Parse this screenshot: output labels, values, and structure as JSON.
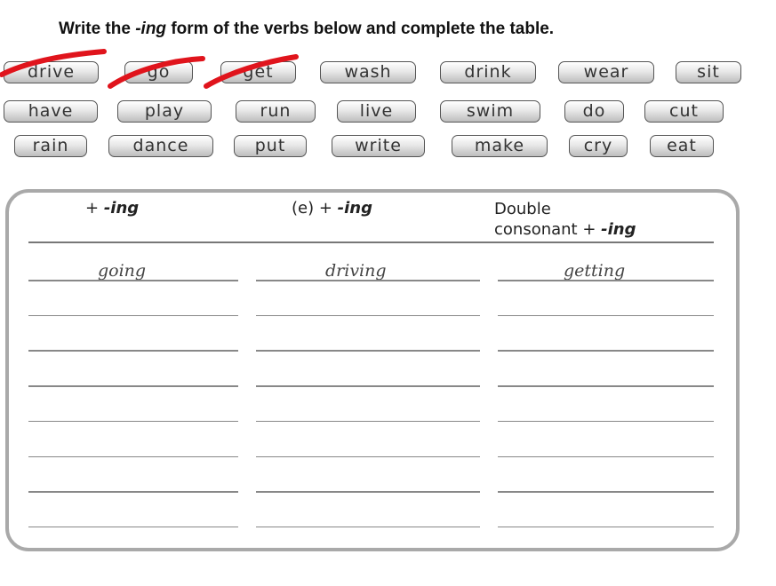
{
  "instruction": {
    "prefix": "Write  the ",
    "emphasis": "-ing",
    "suffix": " form of the verbs below and complete the table."
  },
  "word_bank": [
    {
      "word": "drive",
      "crossed_out": true
    },
    {
      "word": "go",
      "crossed_out": true
    },
    {
      "word": "get",
      "crossed_out": true
    },
    {
      "word": "wash",
      "crossed_out": false
    },
    {
      "word": "drink",
      "crossed_out": false
    },
    {
      "word": "wear",
      "crossed_out": false
    },
    {
      "word": "sit",
      "crossed_out": false
    },
    {
      "word": "have",
      "crossed_out": false
    },
    {
      "word": "play",
      "crossed_out": false
    },
    {
      "word": "run",
      "crossed_out": false
    },
    {
      "word": "live",
      "crossed_out": false
    },
    {
      "word": "swim",
      "crossed_out": false
    },
    {
      "word": "do",
      "crossed_out": false
    },
    {
      "word": "cut",
      "crossed_out": false
    },
    {
      "word": "rain",
      "crossed_out": false
    },
    {
      "word": "dance",
      "crossed_out": false
    },
    {
      "word": "put",
      "crossed_out": false
    },
    {
      "word": "write",
      "crossed_out": false
    },
    {
      "word": "make",
      "crossed_out": false
    },
    {
      "word": "cry",
      "crossed_out": false
    },
    {
      "word": "eat",
      "crossed_out": false
    }
  ],
  "strike_color": "#e0141c",
  "table": {
    "columns": [
      {
        "prefix": "+ ",
        "emphasis": "-ing",
        "line2": ""
      },
      {
        "prefix": "(e) + ",
        "emphasis": "-ing",
        "line2": ""
      },
      {
        "prefix": "Double",
        "emphasis": "",
        "line2_prefix": "consonant + ",
        "line2_emphasis": "-ing"
      }
    ],
    "examples": [
      "going",
      "driving",
      "getting"
    ],
    "blank_rows": 7
  }
}
